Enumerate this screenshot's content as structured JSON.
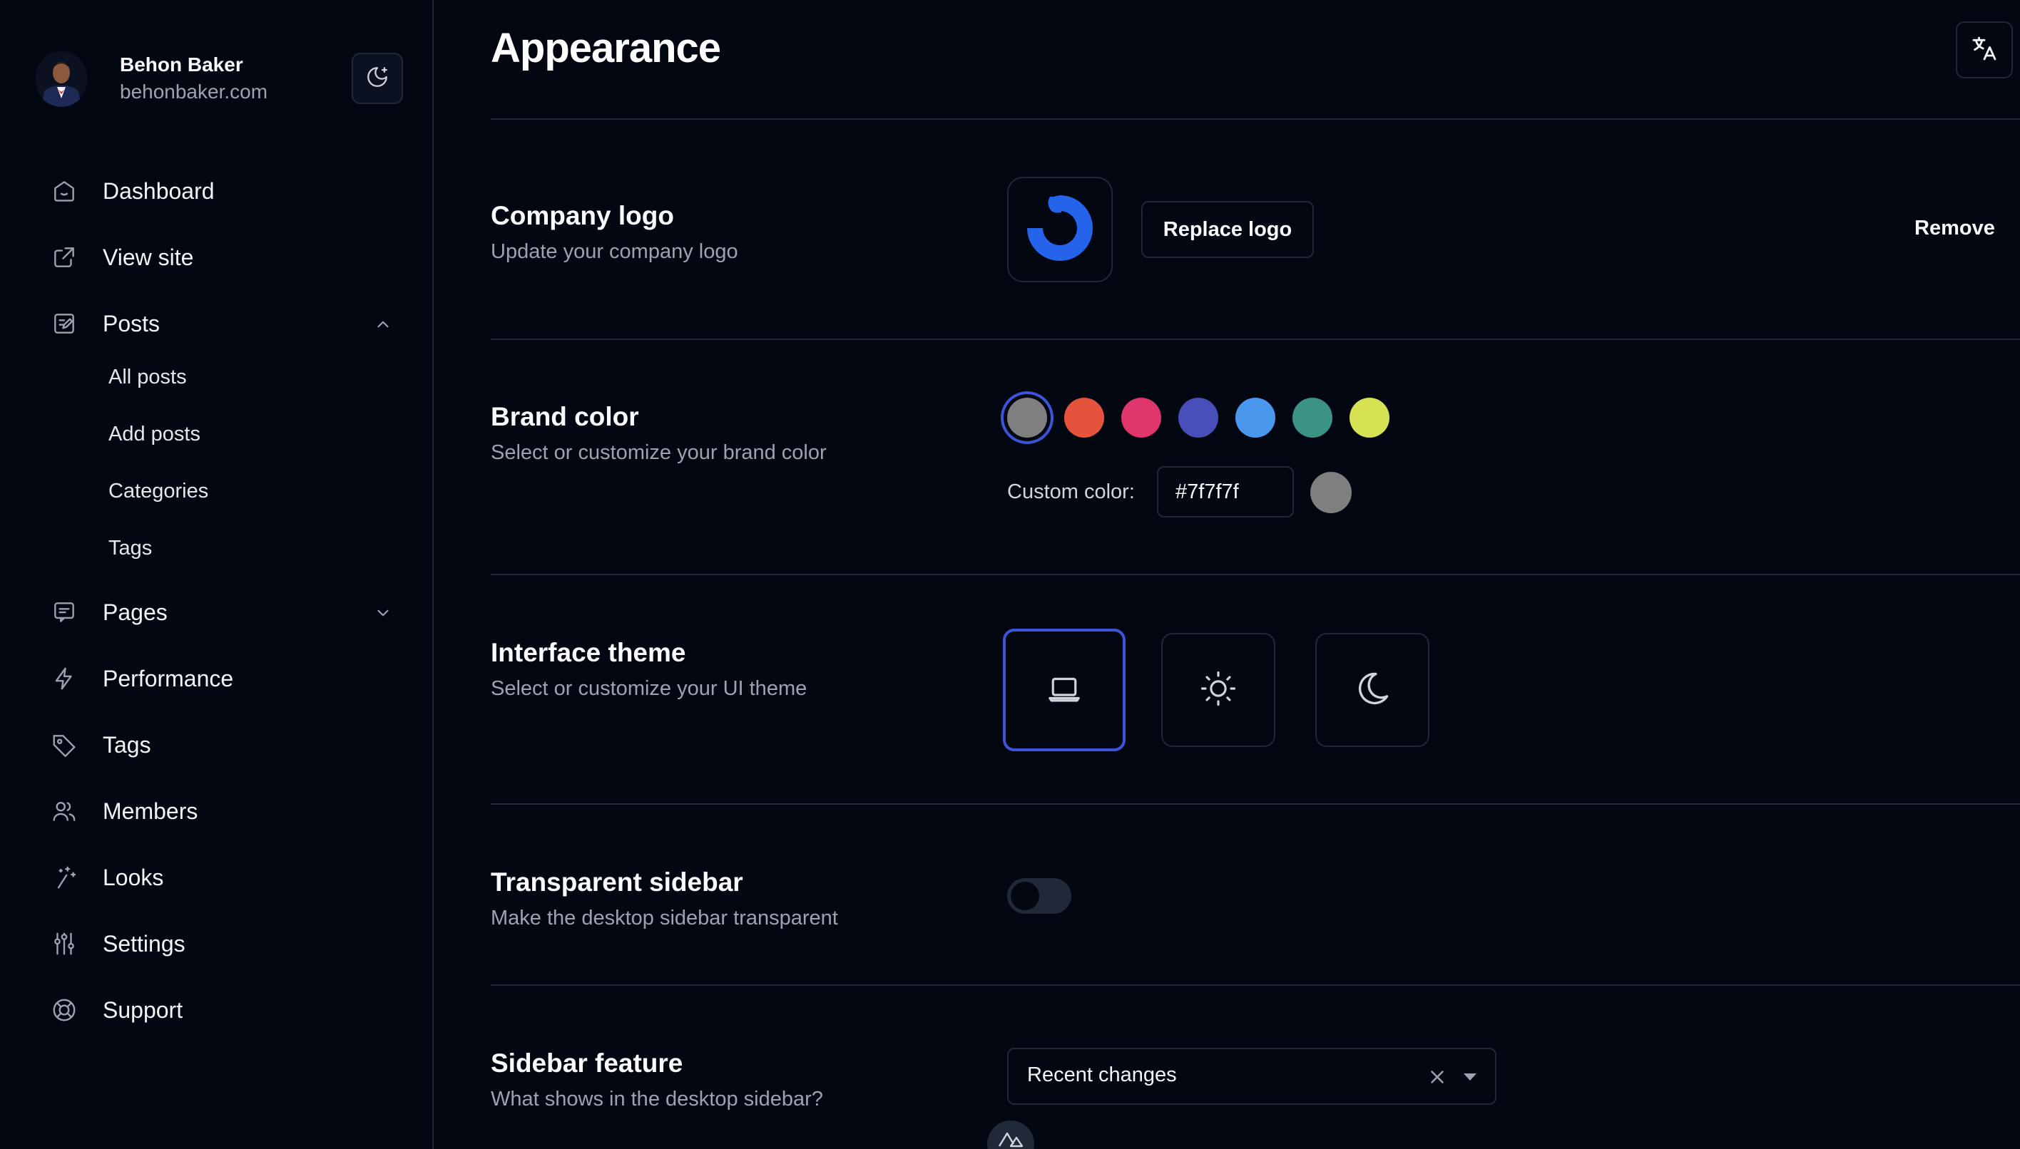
{
  "user": {
    "name": "Behon Baker",
    "site": "behonbaker.com"
  },
  "sidebar": {
    "items": [
      {
        "label": "Dashboard",
        "icon": "home-icon"
      },
      {
        "label": "View site",
        "icon": "external-link-icon"
      },
      {
        "label": "Posts",
        "icon": "edit-icon",
        "expanded": true,
        "children": [
          "All posts",
          "Add posts",
          "Categories",
          "Tags"
        ]
      },
      {
        "label": "Pages",
        "icon": "pages-icon",
        "expanded": false
      },
      {
        "label": "Performance",
        "icon": "bolt-icon"
      },
      {
        "label": "Tags",
        "icon": "tag-icon"
      },
      {
        "label": "Members",
        "icon": "users-icon"
      },
      {
        "label": "Looks",
        "icon": "sparkle-wand-icon"
      },
      {
        "label": "Settings",
        "icon": "sliders-icon"
      },
      {
        "label": "Support",
        "icon": "lifebuoy-icon"
      }
    ]
  },
  "page": {
    "title": "Appearance"
  },
  "sections": {
    "logo": {
      "title": "Company logo",
      "desc": "Update your company logo",
      "replace_label": "Replace logo",
      "remove_label": "Remove"
    },
    "brand": {
      "title": "Brand color",
      "desc": "Select or customize your brand color",
      "swatches": [
        "#7f7f7f",
        "#e5533d",
        "#e0366b",
        "#4650b8",
        "#4a97ee",
        "#3b9483",
        "#d7e253"
      ],
      "selected_index": 0,
      "custom_label": "Custom color:",
      "custom_value": "#7f7f7f"
    },
    "theme": {
      "title": "Interface theme",
      "desc": "Select or customize your UI theme",
      "options": [
        "laptop-icon",
        "sun-icon",
        "moon-icon"
      ],
      "selected_index": 0
    },
    "transparent": {
      "title": "Transparent sidebar",
      "desc": "Make the desktop sidebar transparent",
      "enabled": false
    },
    "feature": {
      "title": "Sidebar feature",
      "desc": "What shows in the desktop sidebar?",
      "value": "Recent changes"
    }
  },
  "colors": {
    "accent": "#3b55d9",
    "logo_blue": "#2563eb"
  }
}
